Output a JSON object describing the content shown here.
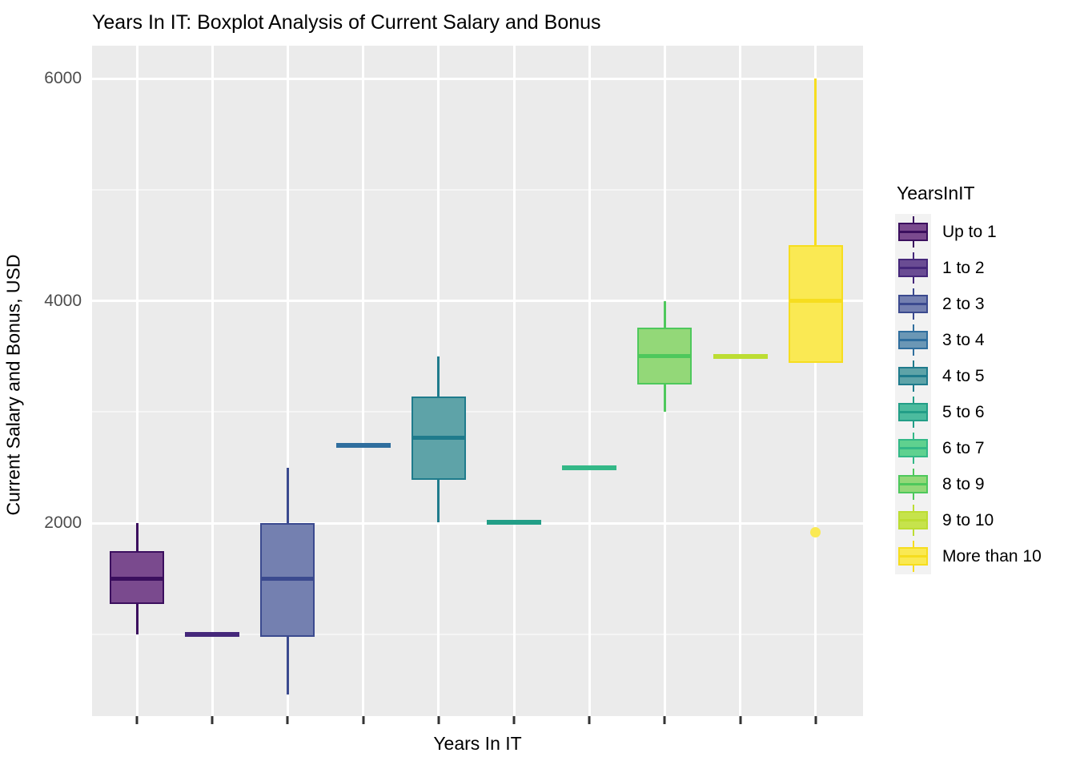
{
  "chart_data": {
    "type": "box",
    "title": "Years In IT: Boxplot Analysis of Current Salary and Bonus",
    "xlabel": "Years In IT",
    "ylabel": "Current Salary and Bonus, USD",
    "legend_title": "YearsInIT",
    "legend_position": "right",
    "grid": true,
    "panel_background": "#ebebeb",
    "gridline_color": "#ffffff",
    "ylim": [
      350,
      6150
    ],
    "yticks": [
      2000,
      4000,
      6000
    ],
    "yticklabels": [
      "2000",
      "4000",
      "6000"
    ],
    "xticklabels": [
      "",
      "",
      "",
      "",
      "",
      "",
      "",
      "",
      "",
      ""
    ],
    "categories": [
      "Up to 1",
      "1 to 2",
      "2 to 3",
      "3 to 4",
      "4 to 5",
      "5 to 6",
      "6 to 7",
      "8 to 9",
      "9 to 10",
      "More than 10"
    ],
    "colors": [
      "#4c2a6b",
      "#6a4c93",
      "#6b79ac",
      "#5589a5",
      "#5fa0a5",
      "#3fb58a",
      "#5ed07e",
      "#8ed973",
      "#bedf3e",
      "#fae441"
    ],
    "boxes": [
      {
        "category": "Up to 1",
        "color": "#7a4a8e",
        "border": "#3b0f5e",
        "whisker_low": 1000,
        "q1": 1270,
        "median": 1500,
        "q3": 1750,
        "whisker_high": 2000,
        "outliers": []
      },
      {
        "category": "1 to 2",
        "color": "#6a4c93",
        "border": "#45277a",
        "whisker_low": 1000,
        "q1": 1000,
        "median": 1000,
        "q3": 1000,
        "whisker_high": 1000,
        "outliers": []
      },
      {
        "category": "2 to 3",
        "color": "#7480b0",
        "border": "#3b4a8f",
        "whisker_low": 460,
        "q1": 975,
        "median": 1500,
        "q3": 2000,
        "whisker_high": 2500,
        "outliers": []
      },
      {
        "category": "3 to 4",
        "color": "#2f6e9e",
        "border": "#2f6e9e",
        "whisker_low": 2700,
        "q1": 2700,
        "median": 2700,
        "q3": 2700,
        "whisker_high": 2700,
        "outliers": []
      },
      {
        "category": "4 to 5",
        "color": "#5ea3a8",
        "border": "#1f7b8c",
        "whisker_low": 2010,
        "q1": 2390,
        "median": 2770,
        "q3": 3140,
        "whisker_high": 3500,
        "outliers": []
      },
      {
        "category": "5 to 6",
        "color": "#229e87",
        "border": "#229e87",
        "whisker_low": 2010,
        "q1": 2010,
        "median": 2010,
        "q3": 2010,
        "whisker_high": 2010,
        "outliers": []
      },
      {
        "category": "6 to 7",
        "color": "#33b887",
        "border": "#33b887",
        "whisker_low": 2500,
        "q1": 2500,
        "median": 2500,
        "q3": 2500,
        "whisker_high": 2500,
        "outliers": []
      },
      {
        "category": "8 to 9",
        "color": "#93d878",
        "border": "#4ec85c",
        "whisker_low": 3000,
        "q1": 3250,
        "median": 3500,
        "q3": 3760,
        "whisker_high": 4000,
        "outliers": []
      },
      {
        "category": "9 to 10",
        "color": "#bcdd33",
        "border": "#bcdd33",
        "whisker_low": 3500,
        "q1": 3500,
        "median": 3500,
        "q3": 3500,
        "whisker_high": 3500,
        "outliers": []
      },
      {
        "category": "More than 10",
        "color": "#fae953",
        "border": "#f6dd1f",
        "whisker_low": 3440,
        "q1": 3440,
        "median": 4000,
        "q3": 4500,
        "whisker_high": 6000,
        "outliers": [
          1920
        ]
      }
    ],
    "legend_entries": [
      {
        "label": "Up to 1",
        "fill": "#7a4a8e",
        "border": "#3b0f5e"
      },
      {
        "label": "1 to 2",
        "fill": "#6a4c93",
        "border": "#45277a"
      },
      {
        "label": "2 to 3",
        "fill": "#7480b0",
        "border": "#3b4a8f"
      },
      {
        "label": "3 to 4",
        "fill": "#6b97b5",
        "border": "#2f6e9e"
      },
      {
        "label": "4 to 5",
        "fill": "#5ea3a8",
        "border": "#1f7b8c"
      },
      {
        "label": "5 to 6",
        "fill": "#4cbb9e",
        "border": "#229e87"
      },
      {
        "label": "6 to 7",
        "fill": "#5fd18f",
        "border": "#33b887"
      },
      {
        "label": "8 to 9",
        "fill": "#93d878",
        "border": "#4ec85c"
      },
      {
        "label": "9 to 10",
        "fill": "#c6e34c",
        "border": "#bcdd33"
      },
      {
        "label": "More than 10",
        "fill": "#fae953",
        "border": "#f6dd1f"
      }
    ]
  }
}
